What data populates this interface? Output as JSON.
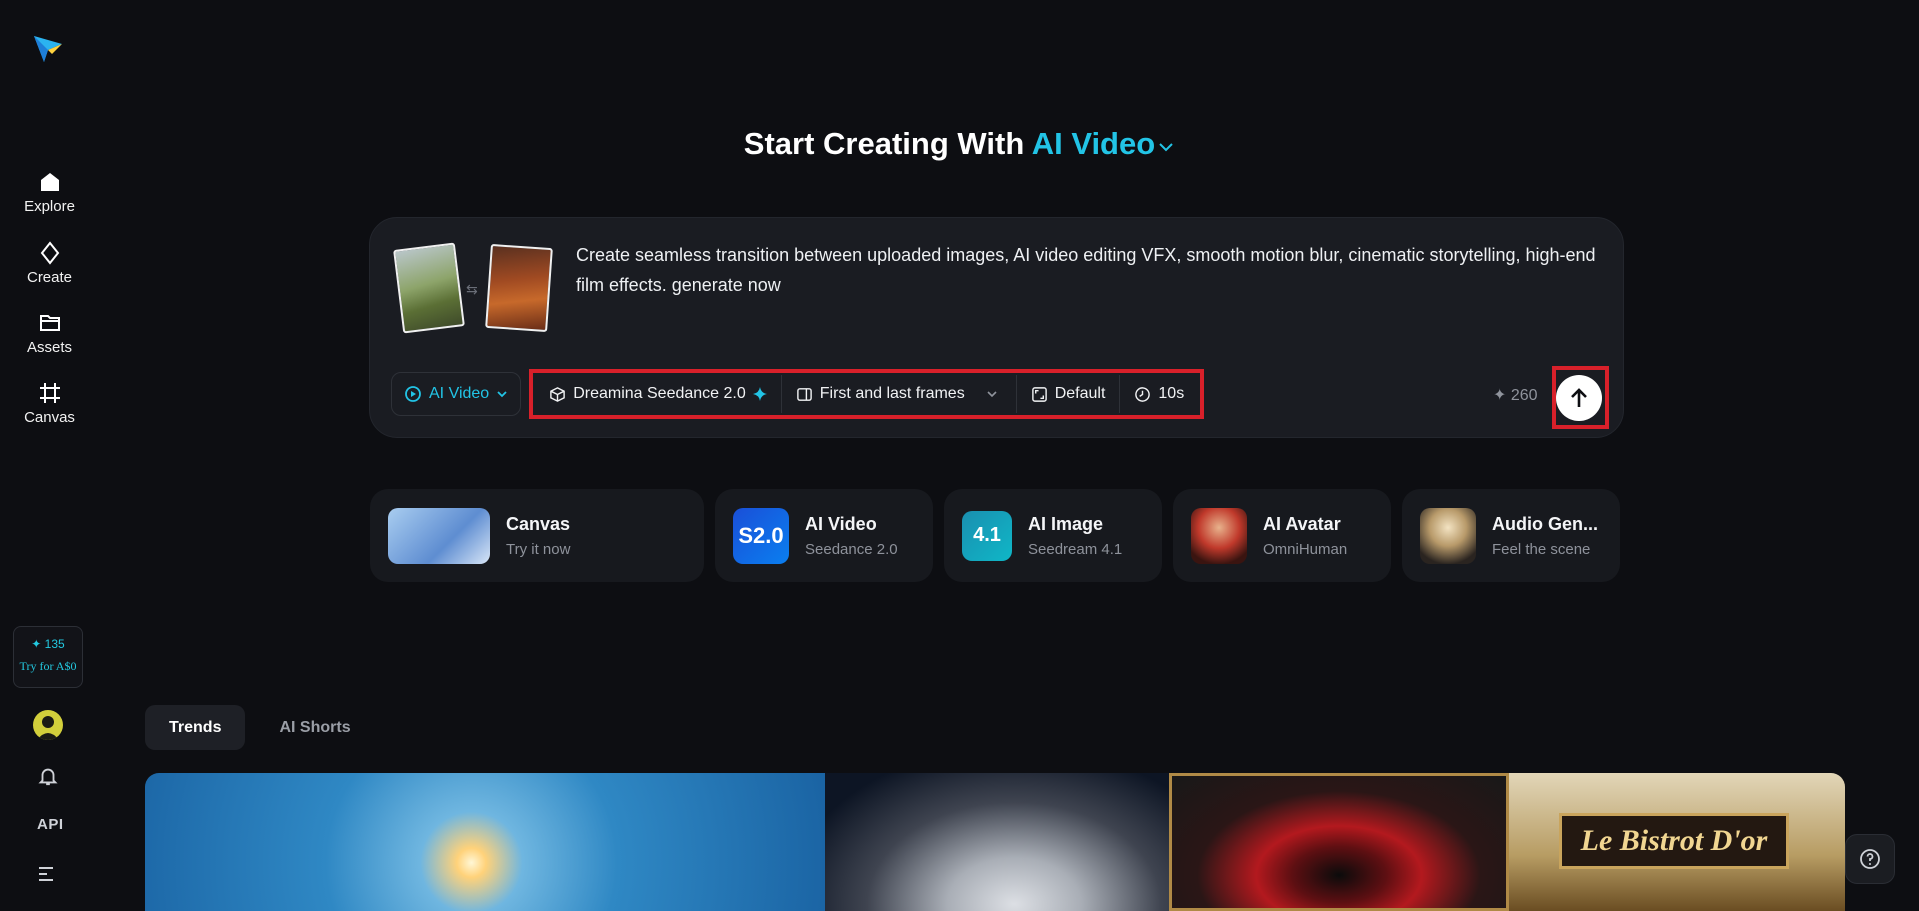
{
  "sidebar": {
    "items": [
      {
        "label": "Explore",
        "icon": "home-icon"
      },
      {
        "label": "Create",
        "icon": "diamond-icon"
      },
      {
        "label": "Assets",
        "icon": "folder-icon"
      },
      {
        "label": "Canvas",
        "icon": "frame-icon"
      }
    ],
    "credits": "✦ 135",
    "try_label": "Try for A$0",
    "api_label": "API"
  },
  "heading": {
    "prefix": "Start Creating With",
    "accent": "AI Video"
  },
  "prompt": {
    "text": "Create seamless transition between uploaded images, AI video editing VFX, smooth motion blur, cinematic storytelling, high-end film effects. generate now",
    "mode_label": "AI Video",
    "model_label": "Dreamina Seedance 2.0",
    "frames_label": "First and last frames",
    "ratio_label": "Default",
    "duration_label": "10s",
    "cost": "260"
  },
  "features": [
    {
      "title": "Canvas",
      "subtitle": "Try it now"
    },
    {
      "title": "AI Video",
      "subtitle": "Seedance 2.0",
      "badge": "S2.0"
    },
    {
      "title": "AI Image",
      "subtitle": "Seedream 4.1",
      "badge": "4.1"
    },
    {
      "title": "AI Avatar",
      "subtitle": "OmniHuman"
    },
    {
      "title": "Audio Gen...",
      "subtitle": "Feel the scene"
    }
  ],
  "tabs": [
    {
      "label": "Trends",
      "active": true
    },
    {
      "label": "AI Shorts",
      "active": false
    }
  ],
  "gallery": {
    "bistro_sign": "Le Bistrot D'or"
  },
  "colors": {
    "accent": "#22c4e6",
    "highlight": "#d8202a",
    "background": "#0d0e12"
  }
}
